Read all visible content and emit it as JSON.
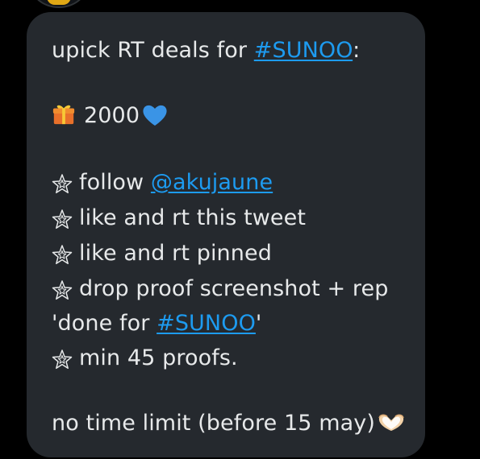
{
  "post": {
    "intro_text": "upick RT deals for ",
    "intro_hashtag": "#SUNOO",
    "intro_suffix": ":",
    "prize_amount": "2000",
    "rules": [
      {
        "text": "follow ",
        "link": "@akujaune"
      },
      {
        "text": "like and rt this tweet"
      },
      {
        "text": "like and rt pinned"
      },
      {
        "text": "drop proof screenshot + rep"
      },
      {
        "continuation_prefix": "'done for ",
        "link": "#SUNOO",
        "continuation_suffix": "'"
      },
      {
        "text": "min 45 proofs."
      }
    ],
    "closing_text": "no time limit (before 15 may)"
  },
  "colors": {
    "background": "#000000",
    "bubble": "#25292e",
    "text": "#e7e9ea",
    "link": "#1d9bf0"
  },
  "icons": {
    "prize": "gift-icon",
    "prize_after": "blue-heart-icon",
    "bullet": "star-outline-icon",
    "closing": "heart-hands-icon"
  }
}
